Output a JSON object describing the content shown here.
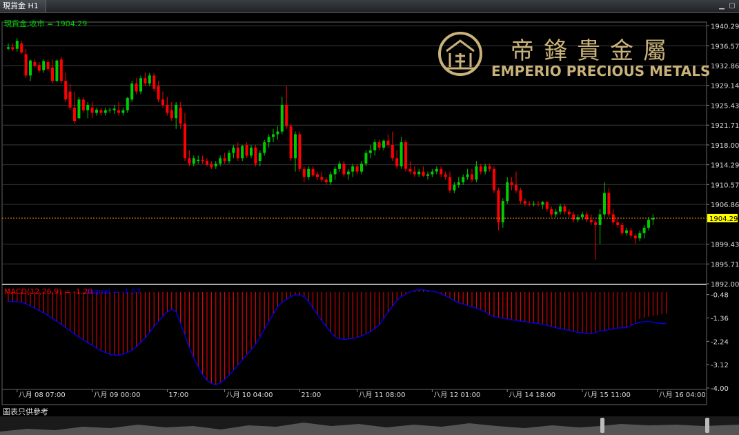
{
  "window": {
    "tab_title": "現貨金 H1",
    "footer": "圖表只供參考"
  },
  "logo": {
    "cn": "帝鋒貴金屬",
    "en": "EMPERIO PRECIOUS METALS",
    "color": "#c9b27a"
  },
  "colors": {
    "up": "#00cc00",
    "down": "#ff0000",
    "grid": "#3a3a3a",
    "text": "#dddddd",
    "signal": "#0000ff",
    "last_price_bg": "#ffff00",
    "last_price_line": "#ff9900"
  },
  "chart_data": [
    {
      "type": "candlestick",
      "title": "現貨金,收市 = 1904.29",
      "last_price": 1904.29,
      "y_ticks": [
        1940.29,
        1936.57,
        1932.86,
        1929.14,
        1925.43,
        1921.71,
        1918.0,
        1914.29,
        1910.57,
        1906.86,
        1899.43,
        1895.71,
        1892.0
      ],
      "ylim": [
        1892.0,
        1941.0
      ],
      "x_labels": [
        {
          "i": 2,
          "label": "八月 08 07:00"
        },
        {
          "i": 19,
          "label": "八月 09 00:00"
        },
        {
          "i": 36,
          "label": "17:00"
        },
        {
          "i": 49,
          "label": "八月 10 04:00"
        },
        {
          "i": 66,
          "label": "21:00"
        },
        {
          "i": 79,
          "label": "八月 11 08:00"
        },
        {
          "i": 96,
          "label": "八月 12 01:00"
        },
        {
          "i": 113,
          "label": "八月 14 18:00"
        },
        {
          "i": 130,
          "label": "八月 15 11:00"
        },
        {
          "i": 147,
          "label": "八月 16 04:00"
        }
      ],
      "ohlc": [
        [
          1936.0,
          1937.0,
          1935.8,
          1936.3
        ],
        [
          1936.3,
          1937.0,
          1935.6,
          1935.9
        ],
        [
          1936.0,
          1938.0,
          1935.5,
          1937.5
        ],
        [
          1937.0,
          1937.5,
          1935.0,
          1935.3
        ],
        [
          1935.0,
          1936.0,
          1930.5,
          1931.0
        ],
        [
          1931.0,
          1934.0,
          1930.0,
          1933.8
        ],
        [
          1933.5,
          1934.0,
          1932.5,
          1932.8
        ],
        [
          1933.0,
          1933.5,
          1931.5,
          1931.9
        ],
        [
          1932.0,
          1934.0,
          1931.5,
          1933.7
        ],
        [
          1933.5,
          1934.0,
          1931.8,
          1932.2
        ],
        [
          1932.5,
          1934.0,
          1929.5,
          1930.0
        ],
        [
          1930.0,
          1934.0,
          1929.8,
          1933.8
        ],
        [
          1934.0,
          1934.5,
          1929.5,
          1930.0
        ],
        [
          1930.0,
          1931.5,
          1926.0,
          1926.5
        ],
        [
          1928.0,
          1929.5,
          1924.5,
          1925.0
        ],
        [
          1925.0,
          1928.0,
          1922.0,
          1922.5
        ],
        [
          1923.0,
          1927.0,
          1922.8,
          1926.5
        ],
        [
          1926.5,
          1927.0,
          1924.0,
          1924.5
        ],
        [
          1924.5,
          1926.0,
          1923.0,
          1925.5
        ],
        [
          1925.0,
          1926.0,
          1923.0,
          1924.0
        ],
        [
          1924.0,
          1925.0,
          1923.5,
          1924.6
        ],
        [
          1924.5,
          1925.0,
          1923.5,
          1924.0
        ],
        [
          1924.0,
          1925.0,
          1923.5,
          1924.5
        ],
        [
          1924.5,
          1925.0,
          1924.0,
          1924.6
        ],
        [
          1924.5,
          1925.5,
          1923.8,
          1924.8
        ],
        [
          1924.5,
          1926.0,
          1923.5,
          1924.0
        ],
        [
          1924.0,
          1925.0,
          1923.5,
          1924.5
        ],
        [
          1924.5,
          1927.0,
          1924.0,
          1926.8
        ],
        [
          1926.5,
          1930.0,
          1926.0,
          1929.5
        ],
        [
          1929.5,
          1930.5,
          1927.5,
          1928.0
        ],
        [
          1928.0,
          1931.0,
          1927.5,
          1930.5
        ],
        [
          1930.5,
          1931.5,
          1929.0,
          1929.5
        ],
        [
          1929.5,
          1931.5,
          1929.0,
          1931.0
        ],
        [
          1931.0,
          1931.5,
          1928.0,
          1928.5
        ],
        [
          1929.0,
          1930.0,
          1926.0,
          1926.5
        ],
        [
          1926.5,
          1928.0,
          1925.0,
          1925.5
        ],
        [
          1925.5,
          1927.0,
          1923.5,
          1924.0
        ],
        [
          1924.5,
          1926.0,
          1922.5,
          1923.0
        ],
        [
          1923.0,
          1926.0,
          1921.0,
          1925.5
        ],
        [
          1925.0,
          1926.0,
          1921.0,
          1922.0
        ],
        [
          1922.0,
          1924.0,
          1915.0,
          1915.5
        ],
        [
          1915.5,
          1917.0,
          1914.0,
          1914.5
        ],
        [
          1914.5,
          1916.0,
          1914.0,
          1915.5
        ],
        [
          1915.0,
          1916.0,
          1914.5,
          1915.2
        ],
        [
          1915.2,
          1916.0,
          1914.5,
          1915.0
        ],
        [
          1915.0,
          1915.5,
          1914.0,
          1914.3
        ],
        [
          1914.5,
          1915.0,
          1913.5,
          1913.8
        ],
        [
          1914.0,
          1915.0,
          1913.5,
          1914.5
        ],
        [
          1914.5,
          1916.0,
          1914.0,
          1915.5
        ],
        [
          1915.5,
          1916.5,
          1914.5,
          1915.0
        ],
        [
          1915.0,
          1917.0,
          1914.5,
          1916.5
        ],
        [
          1916.5,
          1918.0,
          1915.5,
          1917.5
        ],
        [
          1917.5,
          1918.5,
          1915.0,
          1915.5
        ],
        [
          1915.5,
          1918.0,
          1915.0,
          1917.8
        ],
        [
          1918.0,
          1918.5,
          1915.5,
          1916.0
        ],
        [
          1916.0,
          1918.0,
          1915.5,
          1917.5
        ],
        [
          1917.5,
          1918.0,
          1914.0,
          1914.5
        ],
        [
          1915.0,
          1917.0,
          1914.0,
          1916.5
        ],
        [
          1916.5,
          1919.0,
          1916.0,
          1918.5
        ],
        [
          1918.5,
          1920.0,
          1917.5,
          1919.5
        ],
        [
          1919.5,
          1921.0,
          1918.5,
          1920.0
        ],
        [
          1920.0,
          1921.5,
          1919.0,
          1920.5
        ],
        [
          1920.5,
          1927.0,
          1920.0,
          1925.5
        ],
        [
          1925.5,
          1929.0,
          1921.0,
          1921.5
        ],
        [
          1921.5,
          1922.0,
          1915.0,
          1915.5
        ],
        [
          1915.5,
          1920.5,
          1913.0,
          1920.0
        ],
        [
          1920.0,
          1920.5,
          1913.0,
          1913.5
        ],
        [
          1913.5,
          1914.0,
          1911.0,
          1912.0
        ],
        [
          1912.0,
          1914.0,
          1911.5,
          1913.5
        ],
        [
          1913.5,
          1914.0,
          1912.0,
          1912.3
        ],
        [
          1912.5,
          1913.0,
          1911.5,
          1912.0
        ],
        [
          1912.0,
          1913.0,
          1911.0,
          1911.5
        ],
        [
          1911.5,
          1912.0,
          1910.5,
          1911.0
        ],
        [
          1911.0,
          1913.0,
          1910.5,
          1912.5
        ],
        [
          1912.5,
          1914.0,
          1911.5,
          1913.5
        ],
        [
          1913.5,
          1915.0,
          1913.0,
          1914.5
        ],
        [
          1914.5,
          1915.0,
          1912.0,
          1912.5
        ],
        [
          1912.5,
          1913.5,
          1911.5,
          1913.0
        ],
        [
          1913.0,
          1914.5,
          1912.0,
          1914.0
        ],
        [
          1914.0,
          1914.5,
          1912.5,
          1913.0
        ],
        [
          1913.0,
          1915.0,
          1912.5,
          1914.5
        ],
        [
          1914.5,
          1917.0,
          1914.0,
          1916.5
        ],
        [
          1916.5,
          1918.0,
          1915.5,
          1917.0
        ],
        [
          1917.0,
          1919.0,
          1916.0,
          1918.5
        ],
        [
          1918.5,
          1919.0,
          1917.0,
          1917.5
        ],
        [
          1917.5,
          1919.0,
          1917.0,
          1918.8
        ],
        [
          1918.8,
          1920.0,
          1917.5,
          1918.0
        ],
        [
          1918.0,
          1920.5,
          1915.0,
          1915.5
        ],
        [
          1915.5,
          1917.0,
          1913.5,
          1914.0
        ],
        [
          1914.0,
          1919.5,
          1913.5,
          1918.5
        ],
        [
          1918.5,
          1919.0,
          1913.0,
          1913.5
        ],
        [
          1913.5,
          1915.0,
          1912.5,
          1913.0
        ],
        [
          1913.0,
          1914.0,
          1912.0,
          1912.5
        ],
        [
          1912.5,
          1913.5,
          1912.0,
          1913.0
        ],
        [
          1913.0,
          1914.0,
          1912.0,
          1912.2
        ],
        [
          1912.2,
          1913.0,
          1911.5,
          1912.5
        ],
        [
          1912.5,
          1913.5,
          1912.0,
          1913.0
        ],
        [
          1913.0,
          1914.0,
          1912.5,
          1913.5
        ],
        [
          1913.5,
          1914.0,
          1912.0,
          1912.5
        ],
        [
          1912.5,
          1913.0,
          1911.5,
          1912.0
        ],
        [
          1912.0,
          1913.0,
          1909.0,
          1909.5
        ],
        [
          1909.5,
          1911.0,
          1909.0,
          1910.5
        ],
        [
          1910.5,
          1912.0,
          1910.0,
          1911.0
        ],
        [
          1911.0,
          1912.5,
          1910.5,
          1912.0
        ],
        [
          1912.0,
          1913.5,
          1911.5,
          1912.5
        ],
        [
          1912.5,
          1913.5,
          1911.0,
          1911.5
        ],
        [
          1911.5,
          1915.0,
          1911.0,
          1914.0
        ],
        [
          1914.0,
          1914.5,
          1912.5,
          1913.0
        ],
        [
          1913.0,
          1914.5,
          1912.5,
          1914.0
        ],
        [
          1914.0,
          1914.5,
          1913.0,
          1913.5
        ],
        [
          1913.5,
          1914.0,
          1909.0,
          1909.5
        ],
        [
          1909.5,
          1910.0,
          1902.0,
          1903.5
        ],
        [
          1903.5,
          1908.0,
          1902.5,
          1907.5
        ],
        [
          1907.5,
          1912.0,
          1907.0,
          1911.0
        ],
        [
          1911.0,
          1912.0,
          1909.5,
          1910.5
        ],
        [
          1910.5,
          1913.0,
          1909.0,
          1909.5
        ],
        [
          1909.5,
          1910.0,
          1907.0,
          1907.5
        ],
        [
          1907.5,
          1908.0,
          1906.5,
          1907.0
        ],
        [
          1907.0,
          1907.5,
          1906.5,
          1906.8
        ],
        [
          1906.8,
          1907.5,
          1906.5,
          1907.0
        ],
        [
          1907.0,
          1907.5,
          1906.5,
          1906.8
        ],
        [
          1906.8,
          1907.5,
          1906.0,
          1907.3
        ],
        [
          1907.3,
          1907.5,
          1905.5,
          1906.0
        ],
        [
          1906.0,
          1906.5,
          1904.5,
          1905.0
        ],
        [
          1905.0,
          1906.0,
          1904.5,
          1905.5
        ],
        [
          1905.5,
          1907.0,
          1905.0,
          1906.5
        ],
        [
          1906.5,
          1907.0,
          1905.0,
          1905.5
        ],
        [
          1905.5,
          1906.0,
          1904.5,
          1905.0
        ],
        [
          1905.0,
          1905.5,
          1903.5,
          1904.0
        ],
        [
          1904.0,
          1905.0,
          1903.5,
          1904.5
        ],
        [
          1904.5,
          1905.5,
          1904.0,
          1905.0
        ],
        [
          1905.0,
          1905.5,
          1903.5,
          1904.0
        ],
        [
          1904.0,
          1905.0,
          1903.0,
          1903.5
        ],
        [
          1903.5,
          1904.0,
          1896.5,
          1903.0
        ],
        [
          1903.0,
          1906.0,
          1899.5,
          1905.0
        ],
        [
          1905.0,
          1911.0,
          1904.5,
          1909.0
        ],
        [
          1909.0,
          1910.0,
          1904.5,
          1905.0
        ],
        [
          1905.0,
          1906.0,
          1903.0,
          1903.5
        ],
        [
          1903.5,
          1904.5,
          1902.5,
          1903.0
        ],
        [
          1903.0,
          1903.5,
          1901.0,
          1901.5
        ],
        [
          1901.5,
          1902.5,
          1901.0,
          1902.0
        ],
        [
          1902.0,
          1902.5,
          1900.5,
          1901.0
        ],
        [
          1901.0,
          1901.5,
          1899.5,
          1900.5
        ],
        [
          1900.5,
          1902.0,
          1900.0,
          1901.5
        ],
        [
          1901.5,
          1903.0,
          1900.5,
          1902.5
        ],
        [
          1902.5,
          1904.5,
          1902.0,
          1904.0
        ],
        [
          1904.0,
          1905.0,
          1903.0,
          1904.29
        ]
      ]
    },
    {
      "type": "macd",
      "title": "MACD(12,26,9) = -1.20  Signal = -1.57",
      "macd_label": "MACD(12,26,9) = -1.20",
      "signal_label": "Signal = -1.57",
      "y_ticks": [
        -0.48,
        -1.36,
        -2.24,
        -3.12,
        -4.0
      ],
      "ylim": [
        -4.0,
        -0.15
      ],
      "histogram": [
        -0.74,
        -0.74,
        -0.75,
        -0.77,
        -0.83,
        -0.91,
        -0.99,
        -1.08,
        -1.17,
        -1.27,
        -1.38,
        -1.49,
        -1.6,
        -1.72,
        -1.84,
        -1.97,
        -2.08,
        -2.19,
        -2.29,
        -2.39,
        -2.49,
        -2.59,
        -2.66,
        -2.73,
        -2.76,
        -2.76,
        -2.72,
        -2.66,
        -2.58,
        -2.44,
        -2.28,
        -2.11,
        -1.9,
        -1.69,
        -1.49,
        -1.29,
        -1.13,
        -1.03,
        -1.13,
        -1.57,
        -2.01,
        -2.47,
        -2.86,
        -3.21,
        -3.51,
        -3.72,
        -3.82,
        -3.88,
        -3.8,
        -3.68,
        -3.51,
        -3.33,
        -3.14,
        -2.94,
        -2.74,
        -2.56,
        -2.35,
        -2.09,
        -1.78,
        -1.5,
        -1.22,
        -0.94,
        -0.78,
        -0.66,
        -0.56,
        -0.48,
        -0.5,
        -0.56,
        -0.74,
        -0.99,
        -1.24,
        -1.47,
        -1.68,
        -1.9,
        -2.07,
        -2.14,
        -2.17,
        -2.15,
        -2.13,
        -2.09,
        -2.04,
        -1.95,
        -1.88,
        -1.76,
        -1.62,
        -1.38,
        -1.15,
        -0.92,
        -0.7,
        -0.56,
        -0.46,
        -0.38,
        -0.33,
        -0.29,
        -0.3,
        -0.33,
        -0.36,
        -0.38,
        -0.45,
        -0.53,
        -0.61,
        -0.71,
        -0.79,
        -0.84,
        -0.89,
        -0.94,
        -0.99,
        -1.05,
        -1.13,
        -1.25,
        -1.31,
        -1.34,
        -1.37,
        -1.4,
        -1.43,
        -1.45,
        -1.48,
        -1.5,
        -1.53,
        -1.55,
        -1.57,
        -1.6,
        -1.64,
        -1.68,
        -1.73,
        -1.76,
        -1.8,
        -1.83,
        -1.86,
        -1.9,
        -1.92,
        -1.94,
        -1.96,
        -1.91,
        -1.85,
        -1.83,
        -1.8,
        -1.77,
        -1.74,
        -1.73,
        -1.72,
        -1.65,
        -1.51,
        -1.4,
        -1.35,
        -1.31,
        -1.28,
        -1.25,
        -1.22,
        -1.2
      ],
      "signal": [
        -0.74,
        -0.74,
        -0.75,
        -0.77,
        -0.83,
        -0.91,
        -0.99,
        -1.08,
        -1.17,
        -1.27,
        -1.38,
        -1.49,
        -1.6,
        -1.72,
        -1.84,
        -1.97,
        -2.08,
        -2.19,
        -2.29,
        -2.39,
        -2.49,
        -2.59,
        -2.66,
        -2.73,
        -2.76,
        -2.76,
        -2.72,
        -2.66,
        -2.58,
        -2.44,
        -2.28,
        -2.11,
        -1.9,
        -1.69,
        -1.49,
        -1.29,
        -1.13,
        -1.03,
        -1.13,
        -1.57,
        -2.01,
        -2.47,
        -2.86,
        -3.21,
        -3.51,
        -3.72,
        -3.82,
        -3.88,
        -3.8,
        -3.68,
        -3.51,
        -3.33,
        -3.14,
        -2.94,
        -2.74,
        -2.56,
        -2.35,
        -2.09,
        -1.78,
        -1.5,
        -1.22,
        -0.94,
        -0.78,
        -0.66,
        -0.56,
        -0.48,
        -0.5,
        -0.56,
        -0.74,
        -0.99,
        -1.24,
        -1.47,
        -1.68,
        -1.9,
        -2.07,
        -2.14,
        -2.17,
        -2.15,
        -2.13,
        -2.09,
        -2.04,
        -1.95,
        -1.88,
        -1.76,
        -1.62,
        -1.38,
        -1.15,
        -0.92,
        -0.7,
        -0.56,
        -0.46,
        -0.38,
        -0.33,
        -0.29,
        -0.3,
        -0.33,
        -0.36,
        -0.38,
        -0.45,
        -0.53,
        -0.61,
        -0.71,
        -0.79,
        -0.84,
        -0.89,
        -0.94,
        -0.99,
        -1.05,
        -1.13,
        -1.25,
        -1.31,
        -1.34,
        -1.37,
        -1.4,
        -1.43,
        -1.45,
        -1.48,
        -1.5,
        -1.53,
        -1.55,
        -1.57,
        -1.6,
        -1.64,
        -1.68,
        -1.73,
        -1.76,
        -1.8,
        -1.83,
        -1.86,
        -1.9,
        -1.92,
        -1.94,
        -1.96,
        -1.91,
        -1.85,
        -1.83,
        -1.8,
        -1.77,
        -1.74,
        -1.73,
        -1.72,
        -1.65,
        -1.57,
        -1.52,
        -1.5,
        -1.5,
        -1.52,
        -1.55,
        -1.57,
        -1.57
      ]
    }
  ]
}
